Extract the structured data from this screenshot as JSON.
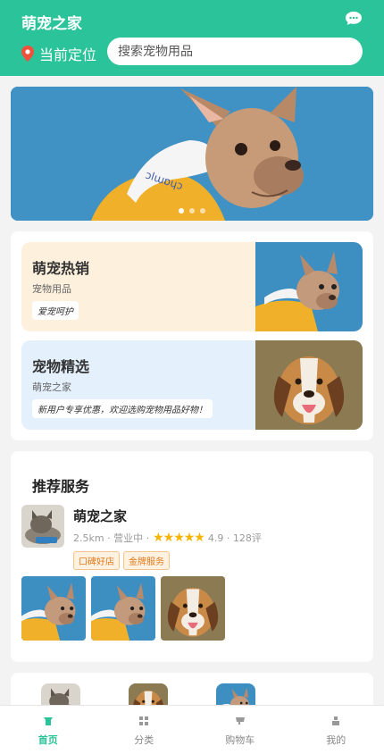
{
  "header": {
    "title": "萌宠之家",
    "location_label": "当前定位",
    "search_placeholder": "搜索宠物用品",
    "chat_icon": "chat-bubble-icon",
    "pin_icon": "location-pin-icon"
  },
  "banner": {
    "slide_count": 3,
    "active_index": 0
  },
  "categories": [
    {
      "title": "萌宠热销",
      "subtitle": "宠物用品",
      "tag": "爱宠呵护"
    },
    {
      "title": "宠物精选",
      "subtitle": "萌宠之家",
      "tag": "新用户专享优惠，欢迎选购宠物用品好物！"
    }
  ],
  "service": {
    "section_title": "推荐服务",
    "shop": {
      "name": "萌宠之家",
      "distance": "2.5km",
      "status": "营业中",
      "rating": "4.9",
      "stars": 5,
      "reviews": "128评",
      "badges": [
        "口碑好店",
        "金牌服务"
      ]
    }
  },
  "tabbar": {
    "items": [
      {
        "label": "首页",
        "icon": "home-icon",
        "active": true
      },
      {
        "label": "分类",
        "icon": "category-grid-icon",
        "active": false
      },
      {
        "label": "购物车",
        "icon": "cart-icon",
        "active": false
      },
      {
        "label": "我的",
        "icon": "user-icon",
        "active": false
      }
    ]
  },
  "colors": {
    "brand": "#2bc39a",
    "star": "#f5b400",
    "badge_text": "#e07a1a"
  }
}
